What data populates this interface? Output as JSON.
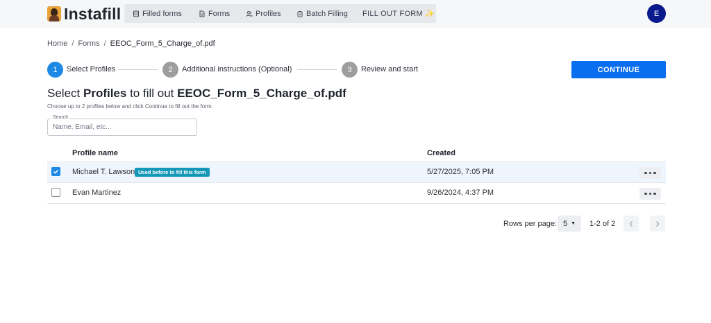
{
  "app": {
    "name": "Instafill"
  },
  "nav": {
    "filled_forms": "Filled forms",
    "forms": "Forms",
    "profiles": "Profiles",
    "batch_filling": "Batch Filling",
    "fill_out_form": "FILL OUT FORM",
    "sparkle_icon": "sparkle"
  },
  "user": {
    "initial": "E",
    "avatar_color": "#0a1a8c"
  },
  "breadcrumb": {
    "items": [
      "Home",
      "Forms",
      "EEOC_Form_5_Charge_of.pdf"
    ],
    "separator": "/"
  },
  "stepper": {
    "steps": [
      {
        "number": "1",
        "label": "Select Profiles",
        "state": "active"
      },
      {
        "number": "2",
        "label": "Additional instructions (Optional)",
        "state": "inactive"
      },
      {
        "number": "3",
        "label": "Review and start",
        "state": "inactive"
      }
    ]
  },
  "actions": {
    "continue_label": "CONTINUE",
    "accent_color": "#0a6ef0"
  },
  "heading": {
    "prefix": "Select ",
    "bold_word": "Profiles",
    "middle": " to fill out ",
    "filename": "EEOC_Form_5_Charge_of.pdf",
    "subtitle": "Choose up to 2 profiles below and click Continue to fill out the form."
  },
  "search": {
    "label": "Search",
    "placeholder": "Name, Email, etc...",
    "value": ""
  },
  "table": {
    "columns": [
      "Profile name",
      "Created"
    ],
    "rows": [
      {
        "selected": true,
        "name": "Michael T. Lawson",
        "badge": "Used before to fill this form",
        "created": "5/27/2025, 7:05 PM"
      },
      {
        "selected": false,
        "name": "Evan Martinez",
        "badge": "",
        "created": "9/26/2024, 4:37 PM"
      }
    ]
  },
  "pagination": {
    "rows_per_page_label": "Rows per page:",
    "rows_per_page": "5",
    "range": "1-2 of 2"
  }
}
